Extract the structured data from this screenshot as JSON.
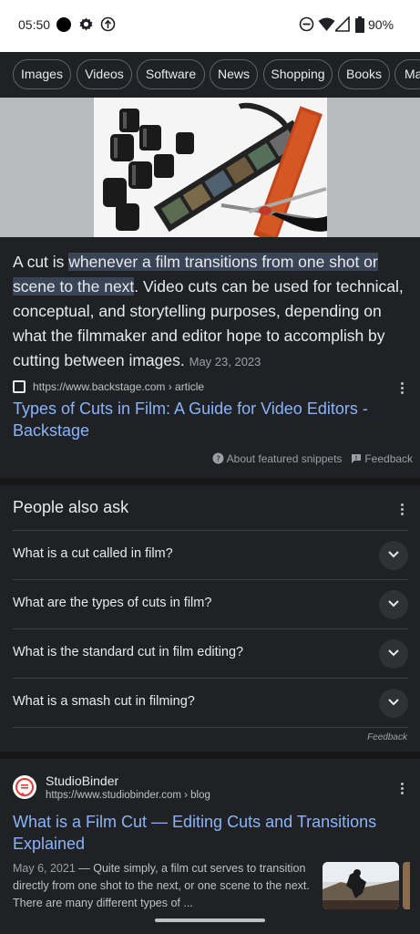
{
  "status_bar": {
    "time": "05:50",
    "battery_text": "90%"
  },
  "chips": [
    "Images",
    "Videos",
    "Software",
    "News",
    "Shopping",
    "Books",
    "Ma"
  ],
  "featured_snippet": {
    "text_before": "A cut is ",
    "text_highlight": "whenever a film transitions from one shot or scene to the next",
    "text_after": ". Video cuts can be used for technical, conceptual, and storytelling purposes, depending on what the filmmaker and editor hope to accomplish by cutting between images.",
    "date": "May 23, 2023",
    "source_url": "https://www.backstage.com › article",
    "title": "Types of Cuts in Film: A Guide for Video Editors - Backstage",
    "about_label": "About featured snippets",
    "feedback_label": "Feedback"
  },
  "people_also_ask": {
    "title": "People also ask",
    "questions": [
      "What is a cut called in film?",
      "What are the types of cuts in film?",
      "What is the standard cut in film editing?",
      "What is a smash cut in filming?"
    ],
    "feedback_label": "Feedback"
  },
  "result2": {
    "site_name": "StudioBinder",
    "url": "https://www.studiobinder.com › blog",
    "title": "What is a Film Cut — Editing Cuts and Transitions Explained",
    "date": "May 6, 2021",
    "description": " — Quite simply, a film cut serves to transition directly from one shot to the next, or one scene to the next. There are many different types of ..."
  },
  "colors": {
    "background": "#202124",
    "link": "#8ab4f8",
    "highlight": "#394457"
  }
}
